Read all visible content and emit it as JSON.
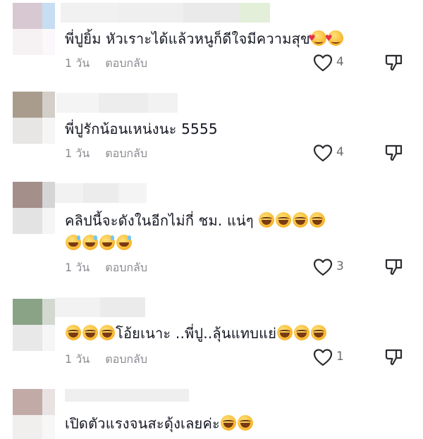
{
  "comments": [
    {
      "text": "พี่ปูยิ้ม หัวเราะได้แล้วหนูก็ดีใจมีความสุข",
      "emojis": [
        "smiling-face-with-hearts",
        "smiling-face-with-hearts"
      ],
      "time": "1 วัน",
      "reply_label": "ตอบกลับ",
      "likes": "4"
    },
    {
      "text": "พี่ปูรักน้อนเหน่งนะ 5555",
      "time": "1 วัน",
      "reply_label": "ตอบกลับ",
      "likes": "4"
    },
    {
      "text": "คลิปนี้จะดังในอีกไม่กี่ ชม. แน่ๆ",
      "emojis_line1": [
        "face-with-tears-of-joy",
        "face-with-tears-of-joy",
        "face-with-tears-of-joy",
        "face-with-tears-of-joy"
      ],
      "emojis_line2": [
        "grinning-face-with-sweat",
        "grinning-face-with-sweat",
        "grinning-face-with-sweat",
        "grinning-face-with-sweat"
      ],
      "time": "1 วัน",
      "reply_label": "ตอบกลับ",
      "likes": "3"
    },
    {
      "text": "โอ้ยเนาะ ..พี่ปู..ลุ้นแทบแย่",
      "emojis_before": [
        "face-with-tears-of-joy",
        "face-with-tears-of-joy",
        "face-with-tears-of-joy"
      ],
      "emojis_after": [
        "face-with-tears-of-joy",
        "face-with-tears-of-joy",
        "face-with-tears-of-joy"
      ],
      "time": "1 วัน",
      "reply_label": "ตอบกลับ",
      "likes": "1"
    },
    {
      "text": "เปิดตัวแรงจนสะดุ้งเลยค่ะ",
      "emojis": [
        "face-with-tears-of-joy",
        "face-with-tears-of-joy"
      ]
    }
  ],
  "icons": {
    "like": "heart-outline-icon",
    "dislike": "thumbs-down-icon"
  },
  "colors": {
    "text": "#161823",
    "meta": "#8a8b91",
    "icon": "#2b2c30"
  }
}
